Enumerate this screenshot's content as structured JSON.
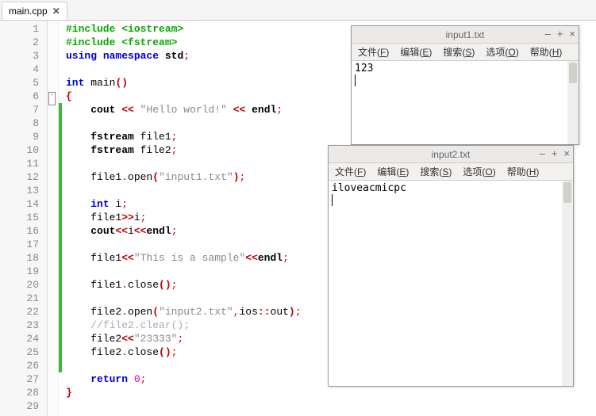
{
  "tab": {
    "name": "main.cpp"
  },
  "gutter": {
    "start": 1,
    "end": 29
  },
  "code": {
    "l1": [
      [
        "pp",
        "#include "
      ],
      [
        "pp",
        "<iostream>"
      ]
    ],
    "l2": [
      [
        "pp",
        "#include "
      ],
      [
        "pp",
        "<fstream>"
      ]
    ],
    "l3": [
      [
        "kw",
        "using"
      ],
      [
        "id",
        " "
      ],
      [
        "kw",
        "namespace"
      ],
      [
        "id",
        " "
      ],
      [
        "ns",
        "std"
      ],
      [
        "pun",
        ";"
      ]
    ],
    "l4": [],
    "l5": [
      [
        "kw",
        "int"
      ],
      [
        "id",
        " "
      ],
      [
        "id",
        "main"
      ],
      [
        "br",
        "()"
      ]
    ],
    "l6": [
      [
        "br",
        "{"
      ]
    ],
    "l7": [
      [
        "id",
        "    "
      ],
      [
        "ns",
        "cout"
      ],
      [
        "id",
        " "
      ],
      [
        "op",
        "<<"
      ],
      [
        "id",
        " "
      ],
      [
        "str",
        "\"Hello world!\""
      ],
      [
        "id",
        " "
      ],
      [
        "op",
        "<<"
      ],
      [
        "id",
        " "
      ],
      [
        "ns",
        "endl"
      ],
      [
        "pun",
        ";"
      ]
    ],
    "l8": [],
    "l9": [
      [
        "id",
        "    "
      ],
      [
        "ns",
        "fstream"
      ],
      [
        "id",
        " file1"
      ],
      [
        "pun",
        ";"
      ]
    ],
    "l10": [
      [
        "id",
        "    "
      ],
      [
        "ns",
        "fstream"
      ],
      [
        "id",
        " file2"
      ],
      [
        "pun",
        ";"
      ]
    ],
    "l11": [],
    "l12": [
      [
        "id",
        "    file1"
      ],
      [
        "pun",
        "."
      ],
      [
        "id",
        "open"
      ],
      [
        "br",
        "("
      ],
      [
        "str",
        "\"input1.txt\""
      ],
      [
        "br",
        ")"
      ],
      [
        "pun",
        ";"
      ]
    ],
    "l13": [],
    "l14": [
      [
        "id",
        "    "
      ],
      [
        "kw",
        "int"
      ],
      [
        "id",
        " i"
      ],
      [
        "pun",
        ";"
      ]
    ],
    "l15": [
      [
        "id",
        "    file1"
      ],
      [
        "op",
        ">>"
      ],
      [
        "id",
        "i"
      ],
      [
        "pun",
        ";"
      ]
    ],
    "l16": [
      [
        "id",
        "    "
      ],
      [
        "ns",
        "cout"
      ],
      [
        "op",
        "<<"
      ],
      [
        "id",
        "i"
      ],
      [
        "op",
        "<<"
      ],
      [
        "ns",
        "endl"
      ],
      [
        "pun",
        ";"
      ]
    ],
    "l17": [],
    "l18": [
      [
        "id",
        "    file1"
      ],
      [
        "op",
        "<<"
      ],
      [
        "str",
        "\"This is a sample\""
      ],
      [
        "op",
        "<<"
      ],
      [
        "ns",
        "endl"
      ],
      [
        "pun",
        ";"
      ]
    ],
    "l19": [],
    "l20": [
      [
        "id",
        "    file1"
      ],
      [
        "pun",
        "."
      ],
      [
        "id",
        "close"
      ],
      [
        "br",
        "()"
      ],
      [
        "pun",
        ";"
      ]
    ],
    "l21": [],
    "l22": [
      [
        "id",
        "    file2"
      ],
      [
        "pun",
        "."
      ],
      [
        "id",
        "open"
      ],
      [
        "br",
        "("
      ],
      [
        "str",
        "\"input2.txt\""
      ],
      [
        "pun",
        ","
      ],
      [
        "id",
        "ios"
      ],
      [
        "op",
        "::"
      ],
      [
        "id",
        "out"
      ],
      [
        "br",
        ")"
      ],
      [
        "pun",
        ";"
      ]
    ],
    "l23": [
      [
        "id",
        "    "
      ],
      [
        "cm",
        "//file2.clear();"
      ]
    ],
    "l24": [
      [
        "id",
        "    file2"
      ],
      [
        "op",
        "<<"
      ],
      [
        "str",
        "\"23333\""
      ],
      [
        "pun",
        ";"
      ]
    ],
    "l25": [
      [
        "id",
        "    file2"
      ],
      [
        "pun",
        "."
      ],
      [
        "id",
        "close"
      ],
      [
        "br",
        "()"
      ],
      [
        "pun",
        ";"
      ]
    ],
    "l26": [],
    "l27": [
      [
        "id",
        "    "
      ],
      [
        "kw",
        "return"
      ],
      [
        "id",
        " "
      ],
      [
        "num",
        "0"
      ],
      [
        "pun",
        ";"
      ]
    ],
    "l28": [
      [
        "br",
        "}"
      ]
    ],
    "l29": []
  },
  "fold_line": 6,
  "change_start": 7,
  "change_end": 26,
  "win1": {
    "title": "input1.txt",
    "menus": [
      "文件(F)",
      "编辑(E)",
      "搜索(S)",
      "选项(O)",
      "帮助(H)"
    ],
    "content": "123"
  },
  "win2": {
    "title": "input2.txt",
    "menus": [
      "文件(F)",
      "编辑(E)",
      "搜索(S)",
      "选项(O)",
      "帮助(H)"
    ],
    "content": "iloveacmicpc"
  }
}
